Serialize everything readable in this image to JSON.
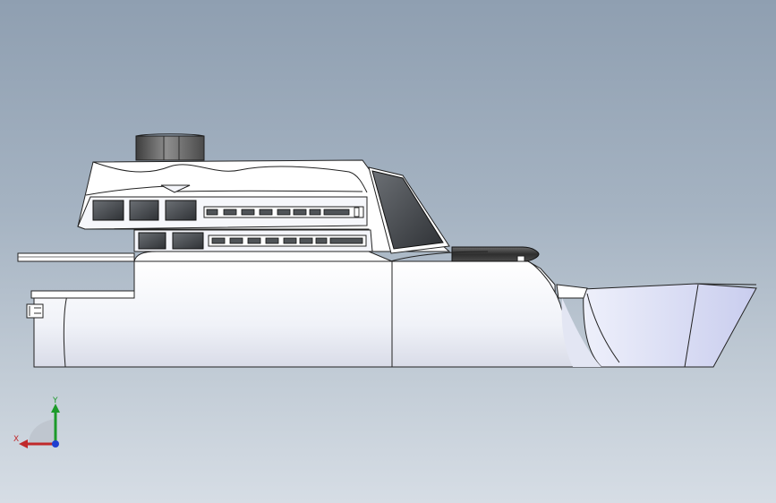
{
  "viewport": {
    "background_top": "#8f9fb1",
    "background_bottom": "#d6dde5",
    "model": "yacht",
    "view": "side elevation"
  },
  "triad": {
    "x_label": "X",
    "y_label": "Y",
    "x_color": "#c0292b",
    "y_color": "#1c9a2a",
    "z_color": "#1f3fd0"
  }
}
